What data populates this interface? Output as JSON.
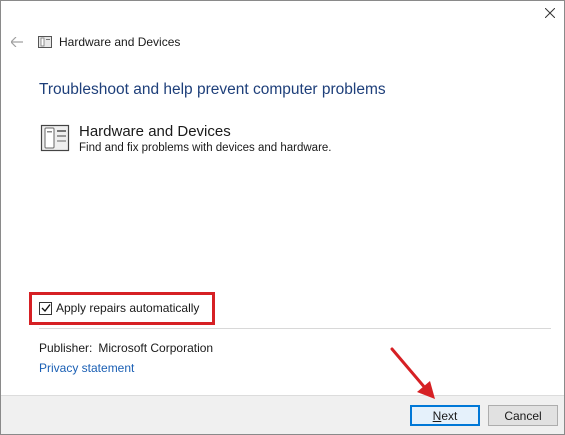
{
  "window": {
    "title": "Hardware and Devices",
    "heading": "Troubleshoot and help prevent computer problems"
  },
  "tool": {
    "name": "Hardware and Devices",
    "description": "Find and fix problems with devices and hardware.",
    "icon": "hardware-device-icon"
  },
  "options": {
    "apply_repairs_label": "Apply repairs automatically",
    "apply_repairs_checked": true
  },
  "info": {
    "publisher_label": "Publisher:",
    "publisher_value": "Microsoft Corporation",
    "privacy_link": "Privacy statement"
  },
  "buttons": {
    "next": "Next",
    "cancel": "Cancel"
  },
  "annotation": {
    "highlight_color": "#d62024",
    "arrow_color": "#d62024"
  }
}
